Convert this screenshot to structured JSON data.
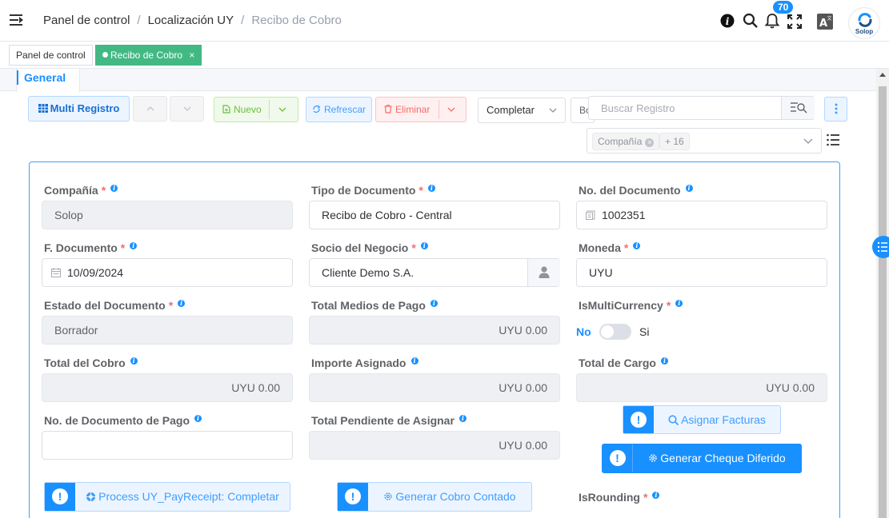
{
  "breadcrumb": {
    "items": [
      "Panel de control",
      "Localización UY",
      "Recibo de Cobro"
    ],
    "separator": "/"
  },
  "topbar": {
    "notifications_count": "70",
    "user_logo_text": "Solop",
    "icons": [
      "info-icon",
      "search-icon",
      "bell-icon",
      "fullscreen-icon",
      "translate-icon"
    ]
  },
  "tags_view": {
    "tabs": [
      {
        "label": "Panel de control",
        "active": false
      },
      {
        "label": "Recibo de Cobro",
        "active": true,
        "close": "×"
      }
    ]
  },
  "panel": {
    "tab_label": "General"
  },
  "toolbar": {
    "multi_record": "Multi Registro",
    "new": "Nuevo",
    "refresh": "Refrescar",
    "delete": "Eliminar",
    "doc_action": "Completar",
    "truncated_button": "Bo",
    "search_placeholder": "Buscar Registro",
    "filter_chip": "Compañía",
    "filter_more": "+ 16"
  },
  "form": {
    "fields": {
      "company": {
        "label": "Compañía",
        "value": "Solop",
        "required": true
      },
      "doc_type": {
        "label": "Tipo de Documento",
        "value": "Recibo de Cobro - Central",
        "required": true
      },
      "doc_no": {
        "label": "No. del Documento",
        "value": "1002351"
      },
      "doc_date": {
        "label": "F. Documento",
        "value": "10/09/2024",
        "required": true
      },
      "bpartner": {
        "label": "Socio del Negocio",
        "value": "Cliente Demo S.A.",
        "required": true
      },
      "currency": {
        "label": "Moneda",
        "value": "UYU",
        "required": true
      },
      "doc_status": {
        "label": "Estado del Documento",
        "value": "Borrador",
        "required": true
      },
      "total_payment_means": {
        "label": "Total Medios de Pago",
        "value": "UYU 0.00"
      },
      "is_multicurrency": {
        "label": "IsMultiCurrency",
        "required": true,
        "off_label": "No",
        "on_label": "Si",
        "checked": false
      },
      "total_receipt": {
        "label": "Total del Cobro",
        "value": "UYU 0.00"
      },
      "assigned_amount": {
        "label": "Importe Asignado",
        "value": "UYU 0.00"
      },
      "total_charge": {
        "label": "Total de Cargo",
        "value": "UYU 0.00"
      },
      "payment_doc_no": {
        "label": "No. de Documento de Pago",
        "value": ""
      },
      "total_pending": {
        "label": "Total Pendiente de Asignar",
        "value": "UYU 0.00"
      },
      "is_rounding": {
        "label": "IsRounding",
        "required": true
      }
    },
    "buttons": {
      "assign_invoices": "Asignar Facturas",
      "generate_deferred_check": "Generar Cheque Diferido",
      "process_receipt": "Process UY_PayReceipt: Completar",
      "generate_cash_receipt": "Generar Cobro Contado"
    },
    "required_mark": "*"
  },
  "colors": {
    "primary": "#1890ff",
    "success": "#42b983",
    "danger": "#f56c6c",
    "readonly_bg": "#eef0f3"
  }
}
